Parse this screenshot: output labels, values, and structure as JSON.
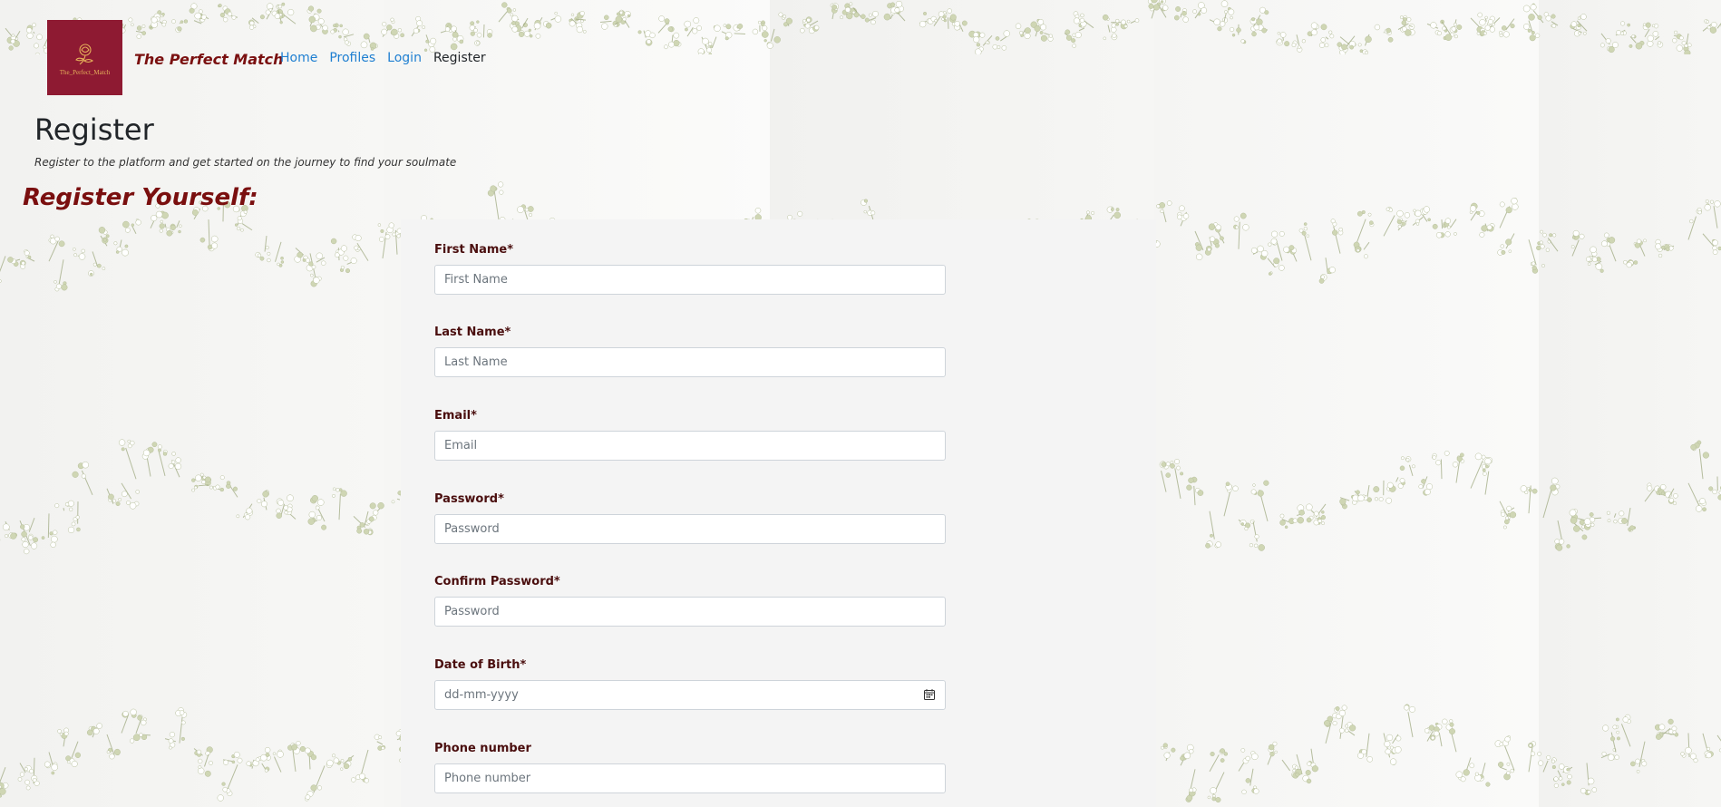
{
  "brand": {
    "logo_text": "The_Perfect_Match",
    "name": "The Perfect Match"
  },
  "nav": {
    "items": [
      {
        "label": "Home"
      },
      {
        "label": "Profiles"
      },
      {
        "label": "Login"
      },
      {
        "label": "Register"
      }
    ]
  },
  "header": {
    "title": "Register",
    "subtitle": "Register to the platform and get started on the journey to find your soulmate"
  },
  "form": {
    "heading": "Register Yourself:",
    "fields": [
      {
        "label": "First Name*",
        "placeholder": "First Name"
      },
      {
        "label": "Last Name*",
        "placeholder": "Last Name"
      },
      {
        "label": "Email*",
        "placeholder": "Email"
      },
      {
        "label": "Password*",
        "placeholder": "Password"
      },
      {
        "label": "Confirm Password*",
        "placeholder": "Password"
      },
      {
        "label": "Date of Birth*",
        "placeholder": "dd-mm-yyyy"
      },
      {
        "label": "Phone number",
        "placeholder": "Phone number"
      }
    ]
  },
  "colors": {
    "brand": "#7a1010",
    "logo_bg": "#8e1a32",
    "link": "#1f7fd1",
    "label": "#4a0e0e"
  },
  "icons": {
    "date": "calendar-icon",
    "logo": "rose-logo-icon"
  }
}
